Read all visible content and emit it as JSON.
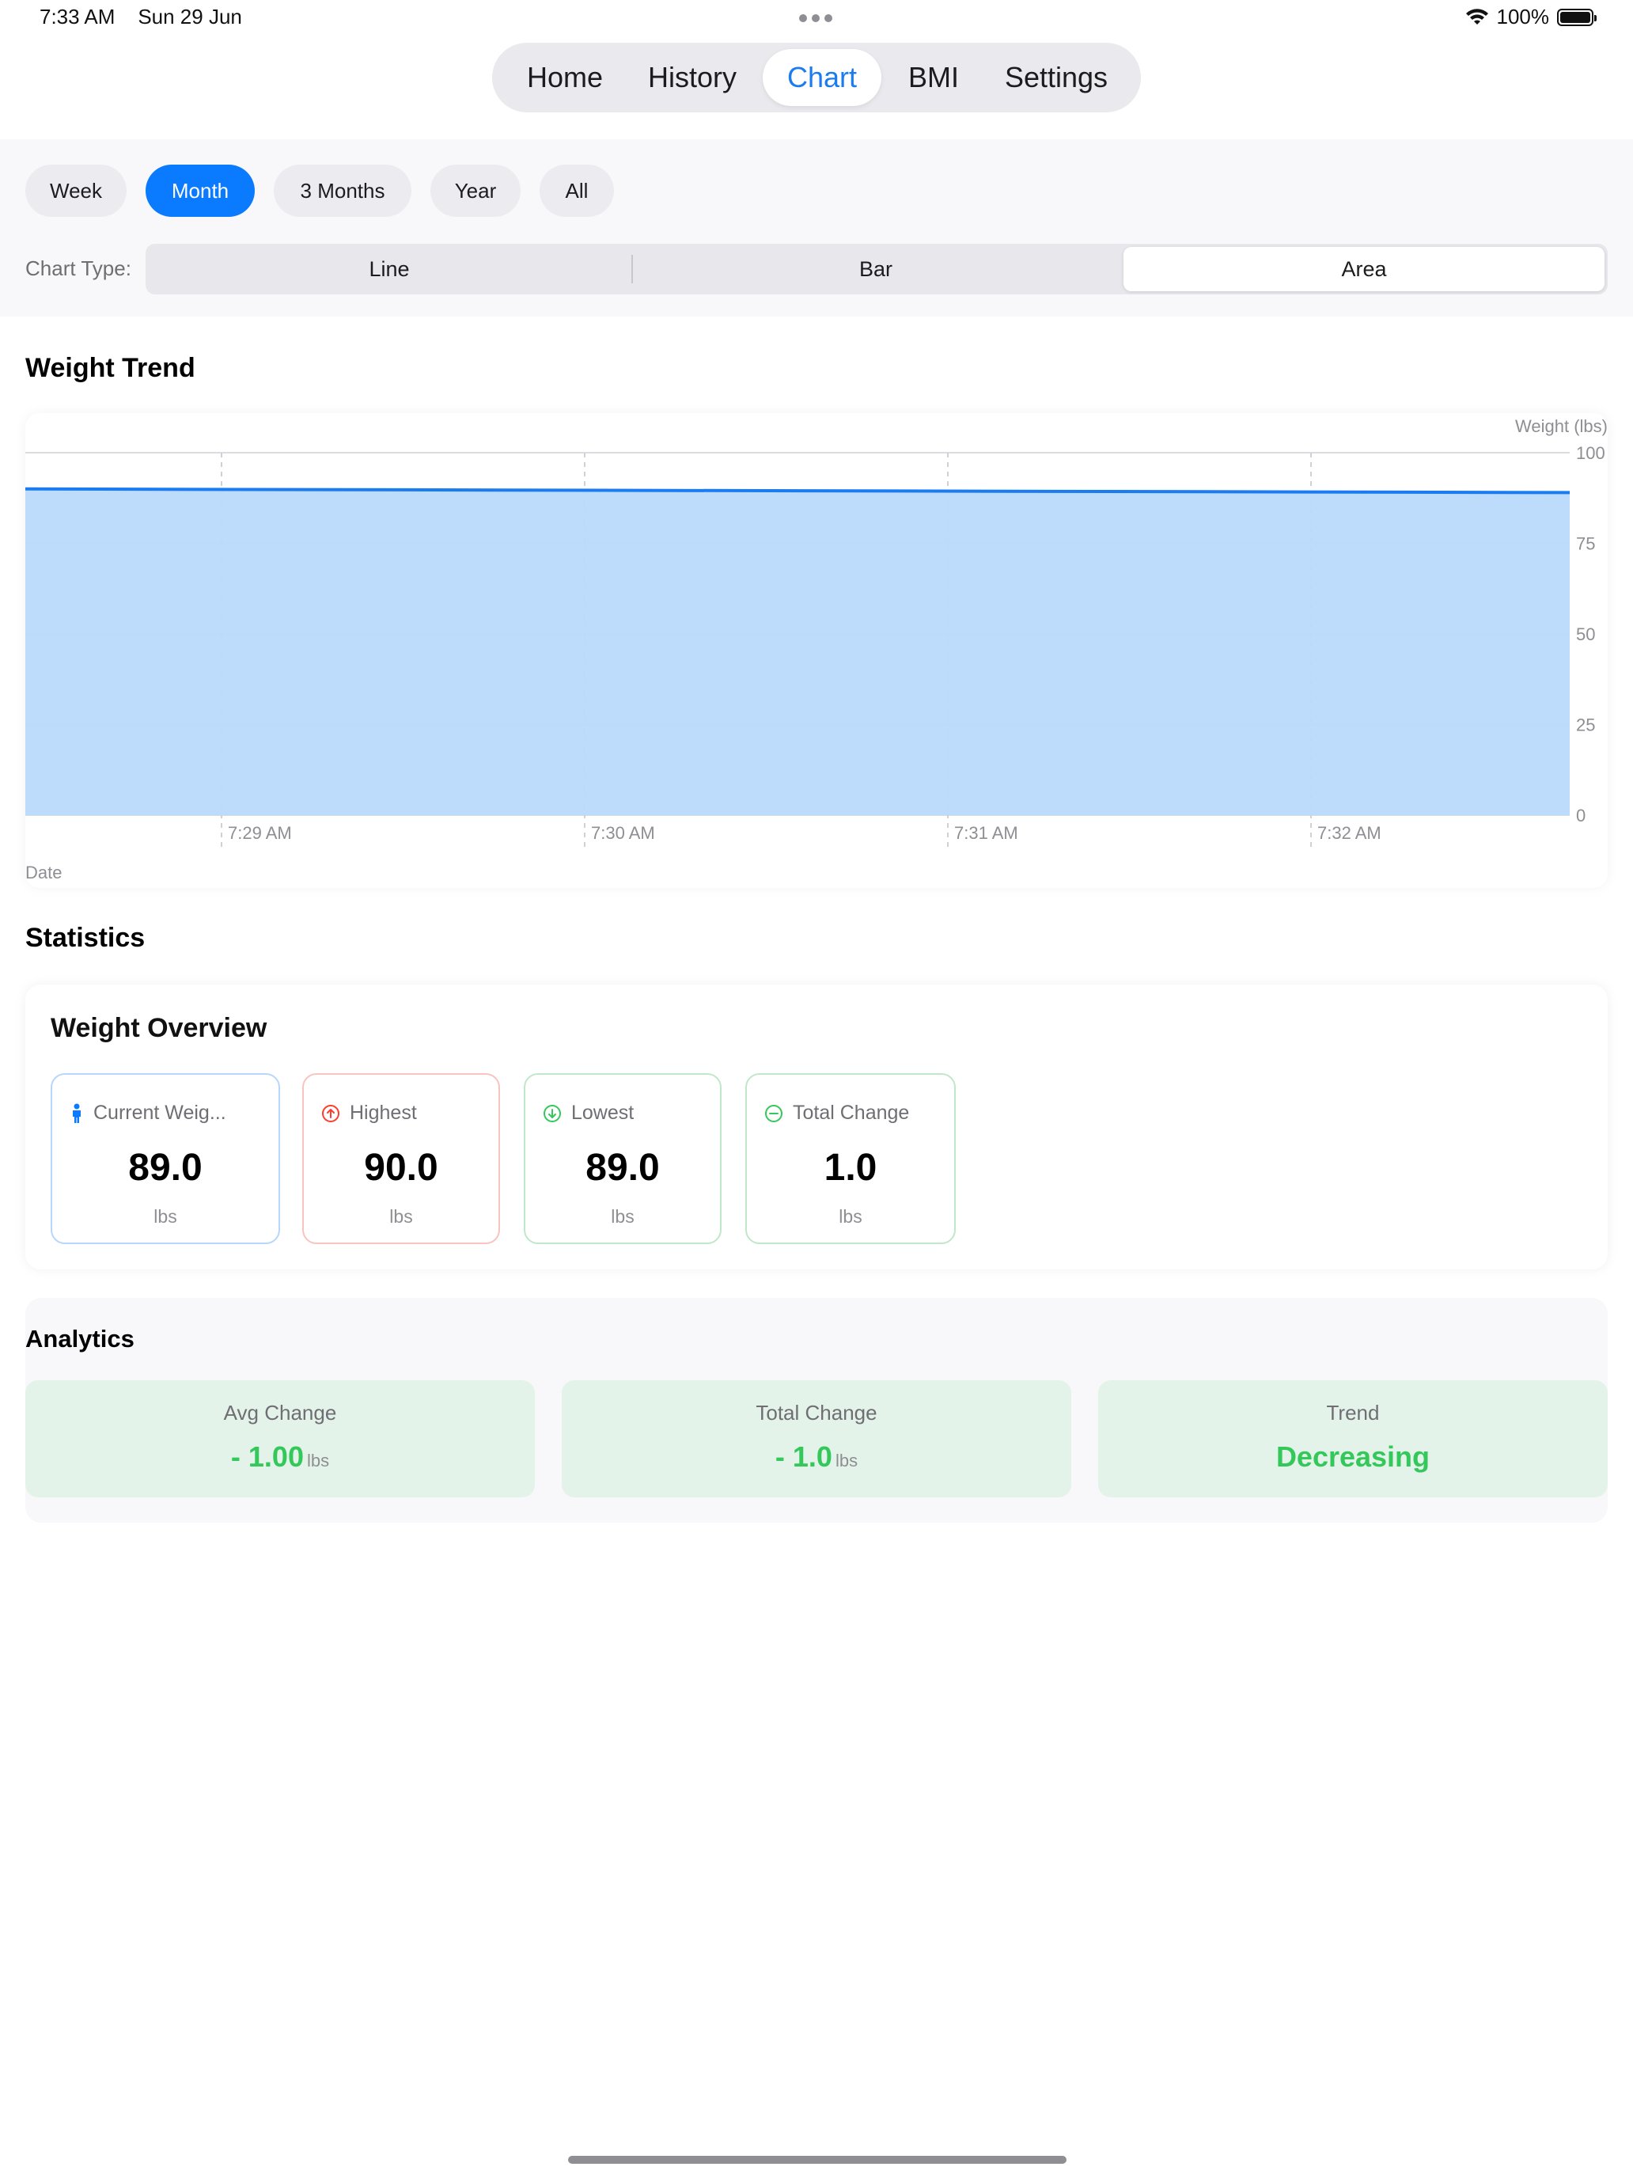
{
  "status_bar": {
    "time": "7:33 AM",
    "date": "Sun 29 Jun",
    "battery": "100%"
  },
  "tabs": [
    {
      "label": "Home",
      "active": false
    },
    {
      "label": "History",
      "active": false
    },
    {
      "label": "Chart",
      "active": true
    },
    {
      "label": "BMI",
      "active": false
    },
    {
      "label": "Settings",
      "active": false
    }
  ],
  "ranges": [
    {
      "label": "Week",
      "active": false
    },
    {
      "label": "Month",
      "active": true
    },
    {
      "label": "3 Months",
      "active": false
    },
    {
      "label": "Year",
      "active": false
    },
    {
      "label": "All",
      "active": false
    }
  ],
  "chart_type": {
    "label": "Chart Type:",
    "options": [
      {
        "label": "Line",
        "active": false
      },
      {
        "label": "Bar",
        "active": false
      },
      {
        "label": "Area",
        "active": true
      }
    ]
  },
  "chart_section_title": "Weight Trend",
  "chart_data": {
    "type": "area",
    "title": "Weight Trend",
    "ylabel": "Weight (lbs)",
    "xlabel": "Date",
    "ylim": [
      0,
      100
    ],
    "yticks": [
      0,
      25,
      50,
      75,
      100
    ],
    "xticks": [
      "7:29 AM",
      "7:30 AM",
      "7:31 AM",
      "7:32 AM"
    ],
    "x": [
      "7:28 AM",
      "7:33 AM"
    ],
    "series": [
      {
        "values": [
          90.0,
          89.0
        ]
      }
    ],
    "grid": true,
    "line_color": "#1a7cf0",
    "fill_color": "#b9d9fb"
  },
  "statistics": {
    "title": "Statistics",
    "card_title": "Weight Overview",
    "items": [
      {
        "icon": "person-icon",
        "label": "Current Weig...",
        "value": "89.0",
        "unit": "lbs",
        "color": "#0a7aff"
      },
      {
        "icon": "arrow-up-circle-icon",
        "label": "Highest",
        "value": "90.0",
        "unit": "lbs",
        "color": "#ff3b30"
      },
      {
        "icon": "arrow-down-circle-icon",
        "label": "Lowest",
        "value": "89.0",
        "unit": "lbs",
        "color": "#34c759"
      },
      {
        "icon": "minus-circle-icon",
        "label": "Total Change",
        "value": "1.0",
        "unit": "lbs",
        "color": "#34c759"
      }
    ]
  },
  "analytics": {
    "title": "Analytics",
    "items": [
      {
        "label": "Avg Change",
        "value": "- 1.00",
        "unit": "lbs"
      },
      {
        "label": "Total Change",
        "value": "- 1.0",
        "unit": "lbs"
      },
      {
        "label": "Trend",
        "value": "Decreasing",
        "unit": ""
      }
    ]
  }
}
